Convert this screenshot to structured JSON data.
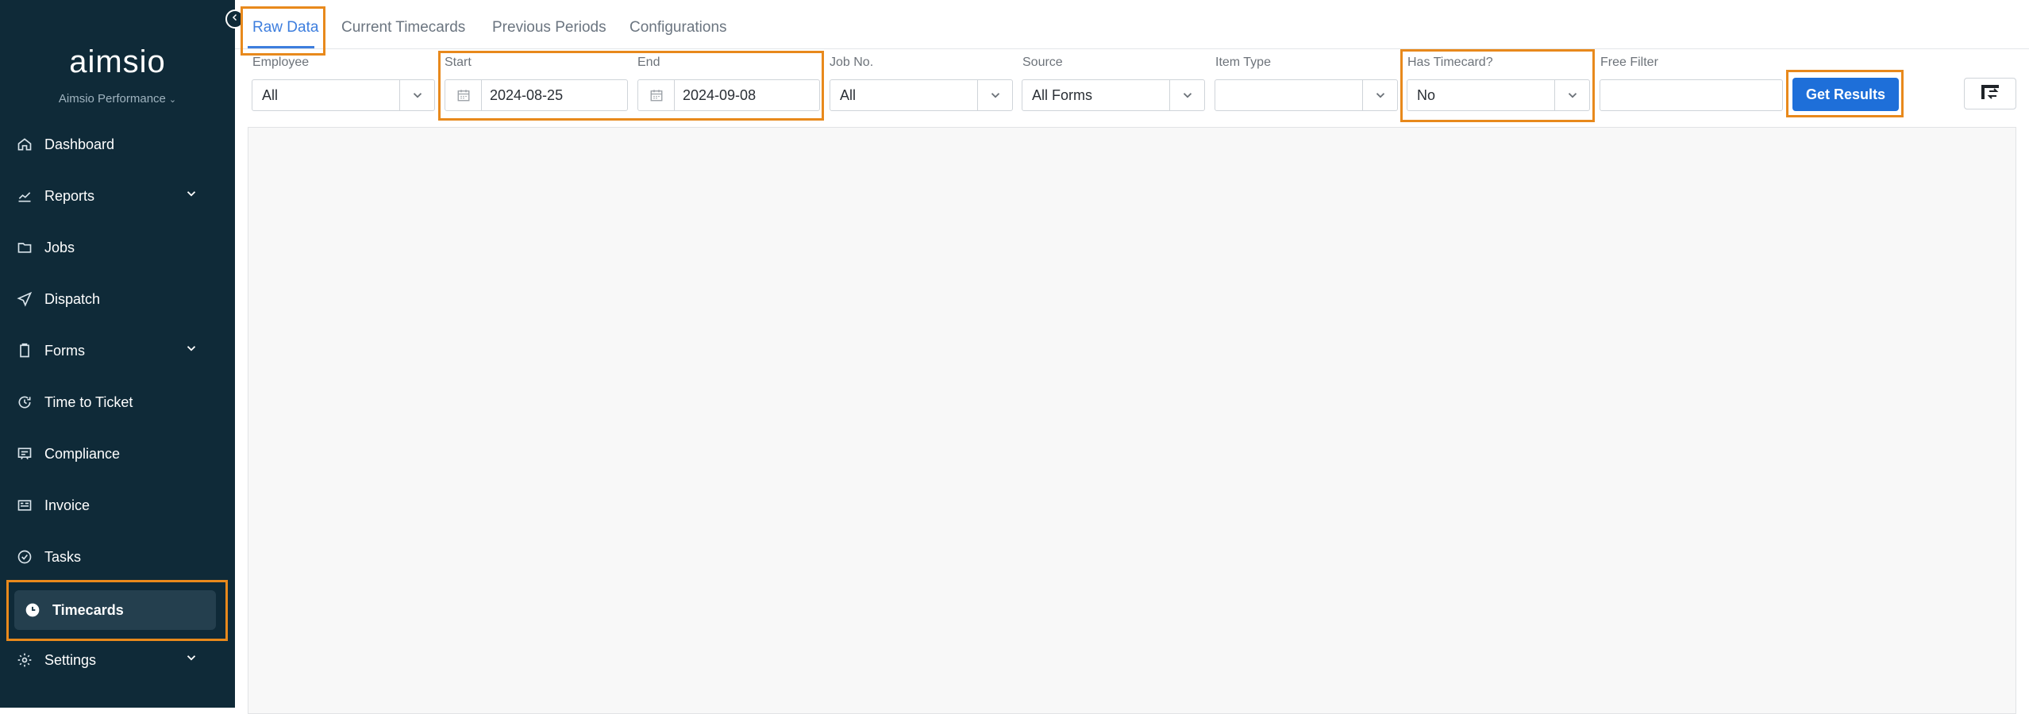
{
  "sidebar": {
    "logo": "aimsio",
    "org": "Aimsio Performance",
    "items": [
      {
        "label": "Dashboard"
      },
      {
        "label": "Reports"
      },
      {
        "label": "Jobs"
      },
      {
        "label": "Dispatch"
      },
      {
        "label": "Forms"
      },
      {
        "label": "Time to Ticket"
      },
      {
        "label": "Compliance"
      },
      {
        "label": "Invoice"
      },
      {
        "label": "Tasks"
      },
      {
        "label": "Timecards"
      },
      {
        "label": "Settings"
      }
    ],
    "active": "Timecards"
  },
  "tabs": [
    {
      "label": "Raw Data"
    },
    {
      "label": "Current Timecards"
    },
    {
      "label": "Previous Periods"
    },
    {
      "label": "Configurations"
    }
  ],
  "active_tab": "Raw Data",
  "filters": {
    "employee": {
      "label": "Employee",
      "value": "All"
    },
    "start": {
      "label": "Start",
      "value": "2024-08-25"
    },
    "end": {
      "label": "End",
      "value": "2024-09-08"
    },
    "job_no": {
      "label": "Job No.",
      "value": "All"
    },
    "source": {
      "label": "Source",
      "value": "All Forms"
    },
    "item_type": {
      "label": "Item Type",
      "value": ""
    },
    "has_timecard": {
      "label": "Has Timecard?",
      "value": "No"
    },
    "free_filter": {
      "label": "Free Filter",
      "value": ""
    }
  },
  "actions": {
    "get_results": "Get Results"
  },
  "colors": {
    "sidebar_bg": "#0f2a38",
    "accent": "#1e6fd9",
    "highlight": "#e8891c"
  }
}
